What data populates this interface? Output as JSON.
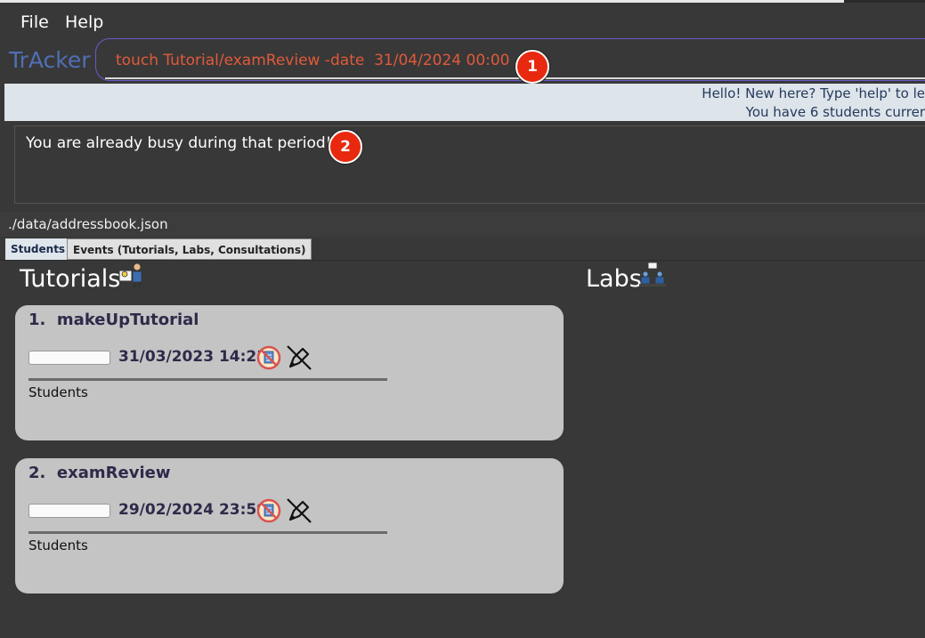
{
  "menu": {
    "file": "File",
    "help": "Help"
  },
  "app_title": "TrAcker",
  "command": {
    "text": "touch Tutorial/examReview -date  31/04/2024 00:00"
  },
  "badges": [
    "1",
    "2"
  ],
  "welcome": {
    "line1": "Hello! New here? Type 'help' to le",
    "line2": "You have 6 students currer"
  },
  "result": "You are already busy during that period!",
  "status": {
    "path": "./data/addressbook.json"
  },
  "tabs": [
    {
      "label": "Students",
      "active": true
    },
    {
      "label": "Events (Tutorials, Labs, Consultations)",
      "active": false
    }
  ],
  "sections": {
    "tutorials": "Tutorials",
    "labs": "Labs"
  },
  "tutorial_cards": [
    {
      "index": "1.",
      "name": "makeUpTutorial",
      "date": "31/03/2023 14:23",
      "students_label": "Students"
    },
    {
      "index": "2.",
      "name": "examReview",
      "date": "29/02/2024 23:59",
      "students_label": "Students"
    }
  ],
  "colors": {
    "background": "#383838",
    "brand": "#4f6fb6",
    "command_text": "#e05a3a",
    "badge": "#e8290f",
    "card": "#c4c4c4",
    "card_text": "#2d2a4a"
  }
}
